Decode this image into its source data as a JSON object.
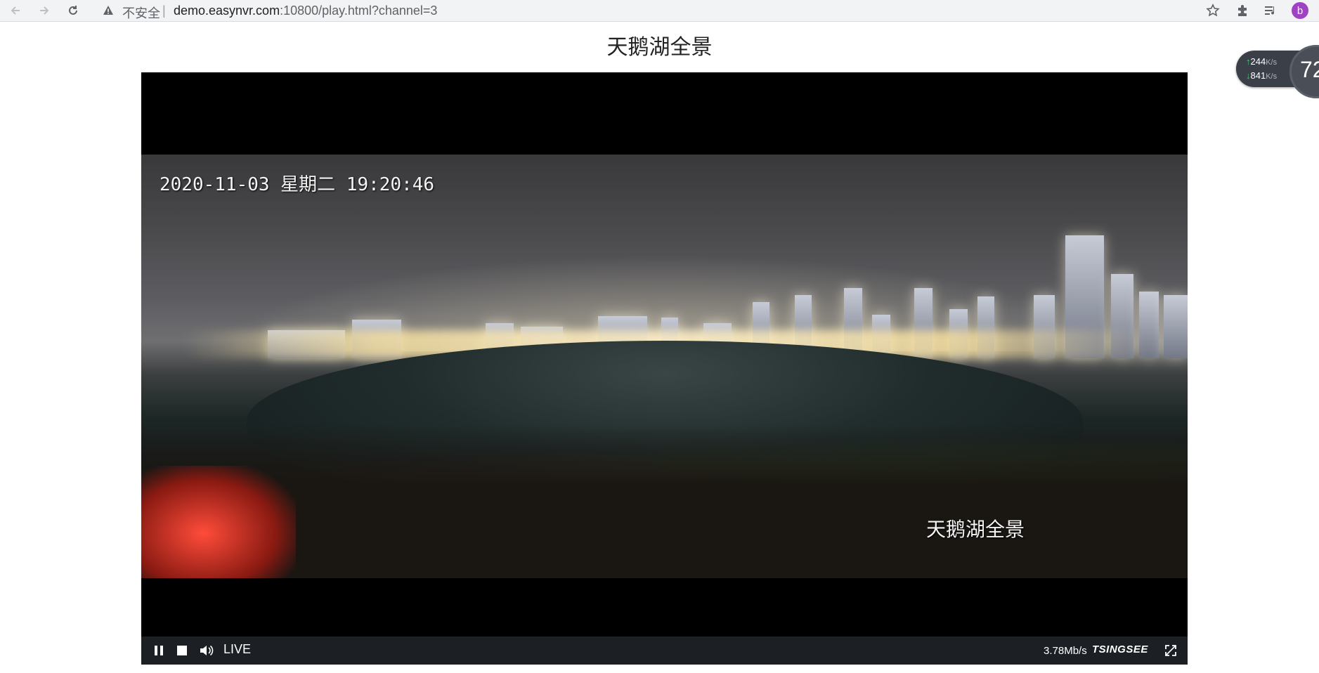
{
  "browser": {
    "insecure_label": "不安全",
    "separator": "|",
    "url_host": "demo.easynvr.com",
    "url_rest": ":10800/play.html?channel=3",
    "profile_initial": "b",
    "icons": [
      "back-arrow-icon",
      "forward-arrow-icon",
      "reload-icon",
      "warning-icon",
      "star-icon",
      "puzzle-icon",
      "media-list-icon"
    ]
  },
  "page": {
    "title": "天鹅湖全景"
  },
  "video": {
    "timestamp_overlay": "2020-11-03 星期二 19:20:46",
    "channel_overlay": "天鹅湖全景"
  },
  "controls": {
    "live_label": "LIVE",
    "bitrate": "3.78Mb/s",
    "brand": "TSINGSEE",
    "icons": [
      "pause-icon",
      "stop-icon",
      "volume-icon",
      "fullscreen-icon"
    ]
  },
  "network": {
    "upload": "244",
    "download": "841",
    "unit": "K/s",
    "gauge_value": "72"
  },
  "colors": {
    "profile": "#a142c4",
    "controls_bg": "#1c2024",
    "widget_bg": "#3b3f47"
  }
}
